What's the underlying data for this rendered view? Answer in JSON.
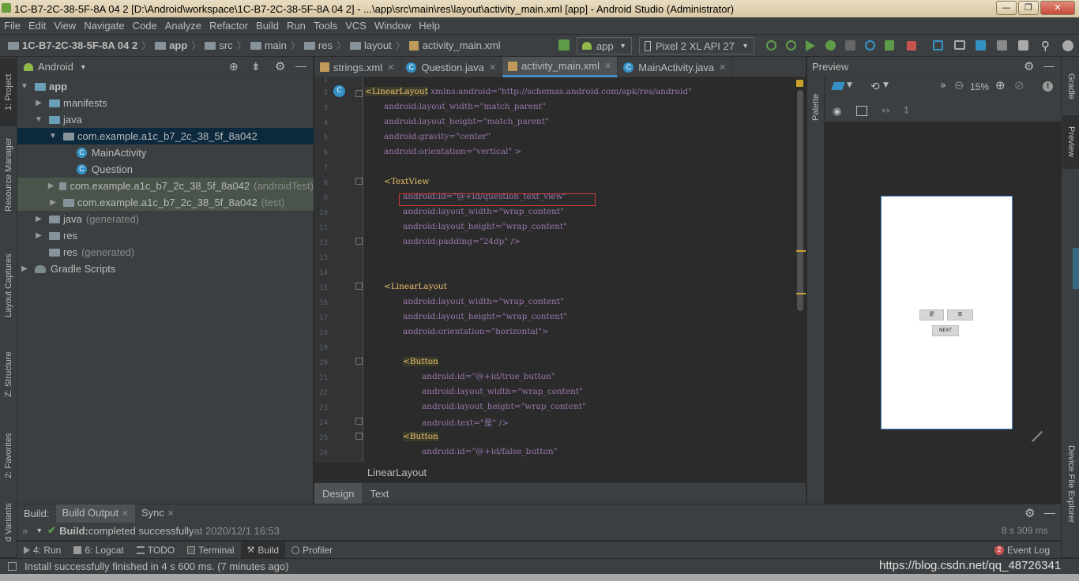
{
  "window": {
    "title": "1C-B7-2C-38-5F-8A 04 2 [D:\\Android\\workspace\\1C-B7-2C-38-5F-8A 04 2] - ...\\app\\src\\main\\res\\layout\\activity_main.xml [app] - Android Studio (Administrator)",
    "minimize": "—",
    "maximize": "❐",
    "close": "✕"
  },
  "menu": [
    "File",
    "Edit",
    "View",
    "Navigate",
    "Code",
    "Analyze",
    "Refactor",
    "Build",
    "Run",
    "Tools",
    "VCS",
    "Window",
    "Help"
  ],
  "nav": {
    "crumbs": [
      "1C-B7-2C-38-5F-8A 04 2",
      "app",
      "src",
      "main",
      "res",
      "layout",
      "activity_main.xml"
    ],
    "run_config": "app",
    "device": "Pixel 2 XL API 27"
  },
  "left_strip": [
    "1: Project",
    "Resource Manager",
    "Layout Captures",
    "Z: Structure",
    "2: Favorites",
    "d Variants"
  ],
  "right_strip": [
    "Gradle",
    "Preview",
    "Device File Explorer"
  ],
  "project": {
    "view": "Android",
    "tree": [
      {
        "label": "app",
        "suffix": ""
      },
      {
        "label": "manifests",
        "suffix": ""
      },
      {
        "label": "java",
        "suffix": ""
      },
      {
        "label": "com.example.a1c_b7_2c_38_5f_8a042",
        "suffix": ""
      },
      {
        "label": "MainActivity",
        "suffix": ""
      },
      {
        "label": "Question",
        "suffix": ""
      },
      {
        "label": "com.example.a1c_b7_2c_38_5f_8a042",
        "suffix": "(androidTest)"
      },
      {
        "label": "com.example.a1c_b7_2c_38_5f_8a042",
        "suffix": "(test)"
      },
      {
        "label": "java",
        "suffix": "(generated)"
      },
      {
        "label": "res",
        "suffix": ""
      },
      {
        "label": "res",
        "suffix": "(generated)"
      },
      {
        "label": "Gradle Scripts",
        "suffix": ""
      }
    ]
  },
  "editor": {
    "tabs": [
      "strings.xml",
      "Question.java",
      "activity_main.xml",
      "MainActivity.java"
    ],
    "line_numbers": [
      "1",
      "2",
      "3",
      "4",
      "5",
      "6",
      "7",
      "8",
      "9",
      "10",
      "11",
      "12",
      "13",
      "14",
      "15",
      "16",
      "17",
      "18",
      "19",
      "20",
      "21",
      "22",
      "23",
      "24",
      "25",
      "26"
    ],
    "breadcrumb": "LinearLayout",
    "modes": [
      "Design",
      "Text"
    ],
    "code": {
      "l2_tag": "LinearLayout",
      "l2_rest": " xmlns:android=\"http://schemas.android.com/apk/res/android\"",
      "l3": "android:layout_width=\"match_parent\"",
      "l4": "android:layout_height=\"match_parent\"",
      "l5": "android:gravity=\"center\"",
      "l6": "android:orientation=\"vertical\" >",
      "l8": "TextView",
      "l9": "android:id=\"@+id/question_text_view\"",
      "l10": "android:layout_width=\"wrap_content\"",
      "l11": "android:layout_height=\"wrap_content\"",
      "l12": "android:padding=\"24dp\" />",
      "l15": "LinearLayout",
      "l16": "android:layout_width=\"wrap_content\"",
      "l17": "android:layout_height=\"wrap_content\"",
      "l18": "android:orientation=\"horizontal\">",
      "l20": "Button",
      "l21": "android:id=\"@+id/true_button\"",
      "l22": "android:layout_width=\"wrap_content\"",
      "l23": "android:layout_height=\"wrap_content\"",
      "l24": "android:text=\"是\" />",
      "l25": "Button",
      "l26": "android:id=\"@+id/false_button\""
    }
  },
  "preview": {
    "title": "Preview",
    "palette": "Palette",
    "zoom": "15%",
    "buttons": {
      "yes": "是",
      "no": "否",
      "next": "NEXT"
    }
  },
  "build": {
    "label": "Build:",
    "tabs": [
      "Build Output",
      "Sync"
    ],
    "status_bold": "Build:",
    "status_text": " completed successfully",
    "status_time": " at 2020/12/1 16:53",
    "duration": "8 s 309 ms"
  },
  "bottom_tabs": [
    "4: Run",
    "6: Logcat",
    "TODO",
    "Terminal",
    "Build",
    "Profiler"
  ],
  "event_log": {
    "count": "2",
    "label": "Event Log"
  },
  "status": {
    "message": "Install successfully finished in 4 s 600 ms. (7 minutes ago)",
    "watermark": "https://blog.csdn.net/qq_48726341"
  }
}
